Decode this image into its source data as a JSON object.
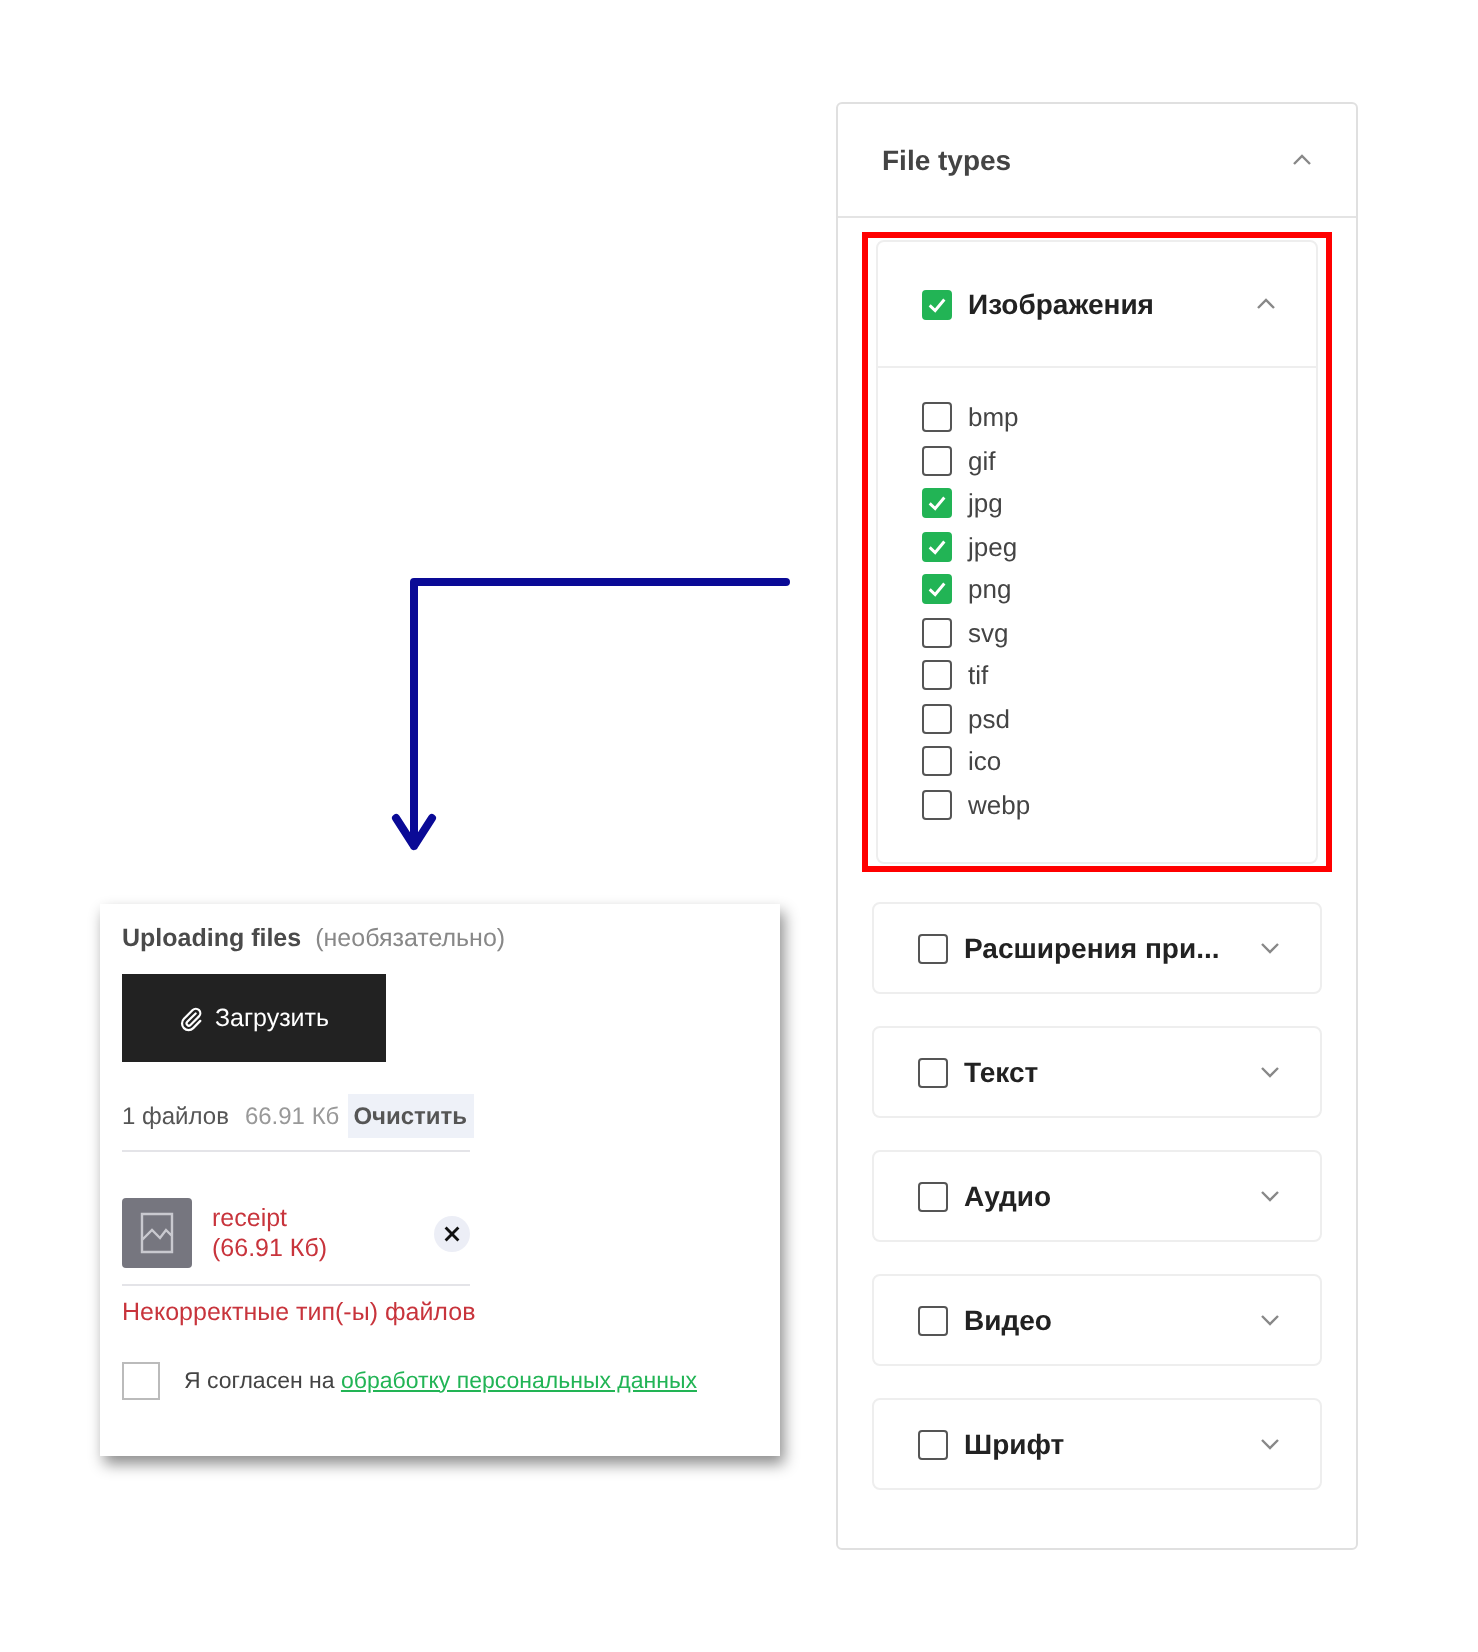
{
  "upload": {
    "title": "Uploading files",
    "optional": "(необязательно)",
    "button": "Загрузить",
    "file_count": "1 файлов",
    "total_size": "66.91 Кб",
    "clear": "Очистить",
    "files": [
      {
        "name": "receipt",
        "size": "(66.91 Кб)",
        "invalid": true
      }
    ],
    "error": "Некорректные тип(-ы) файлов",
    "consent": {
      "checked": false,
      "text": "Я согласен на",
      "link": "обработку персональных данных"
    }
  },
  "file_types": {
    "title": "File types",
    "expanded": true,
    "groups": [
      {
        "label": "Изображения",
        "checked": true,
        "expanded": true,
        "highlighted": true,
        "children": [
          {
            "label": "bmp",
            "checked": false
          },
          {
            "label": "gif",
            "checked": false
          },
          {
            "label": "jpg",
            "checked": true
          },
          {
            "label": "jpeg",
            "checked": true
          },
          {
            "label": "png",
            "checked": true
          },
          {
            "label": "svg",
            "checked": false
          },
          {
            "label": "tif",
            "checked": false
          },
          {
            "label": "psd",
            "checked": false
          },
          {
            "label": "ico",
            "checked": false
          },
          {
            "label": "webp",
            "checked": false
          }
        ]
      },
      {
        "label": "Расширения при...",
        "checked": false,
        "expanded": false,
        "highlighted": false
      },
      {
        "label": "Текст",
        "checked": false,
        "expanded": false,
        "highlighted": false
      },
      {
        "label": "Аудио",
        "checked": false,
        "expanded": false,
        "highlighted": false
      },
      {
        "label": "Видео",
        "checked": false,
        "expanded": false,
        "highlighted": false
      },
      {
        "label": "Шрифт",
        "checked": false,
        "expanded": false,
        "highlighted": false
      }
    ]
  }
}
